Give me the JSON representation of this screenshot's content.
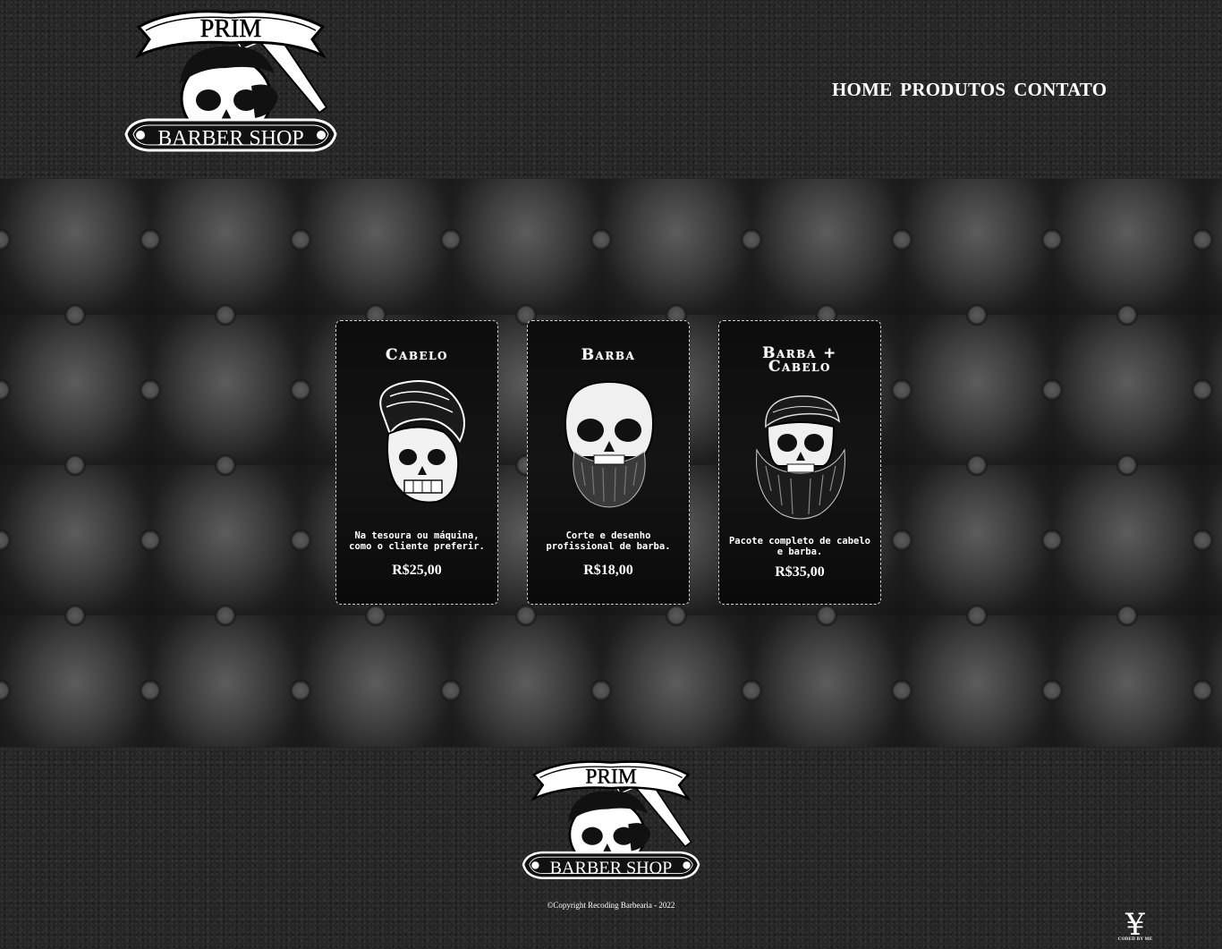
{
  "brand": {
    "logo_top": "PRIM",
    "logo_bottom": "BARBER SHOP"
  },
  "nav": {
    "items": [
      {
        "label": "HOME"
      },
      {
        "label": "PRODUTOS"
      },
      {
        "label": "CONTATO"
      }
    ]
  },
  "products": [
    {
      "title_lines": [
        "Cabelo"
      ],
      "description": "Na tesoura ou máquina, como o cliente preferir.",
      "price": "R$25,00",
      "icon": "pompadour-skull-icon"
    },
    {
      "title_lines": [
        "Barba"
      ],
      "description": "Corte e desenho profissional de barba.",
      "price": "R$18,00",
      "icon": "bearded-skull-icon"
    },
    {
      "title_lines": [
        "Barba +",
        "Cabelo"
      ],
      "description": "Pacote completo de cabelo e barba.",
      "price": "R$35,00",
      "icon": "hair-beard-skull-icon"
    }
  ],
  "footer": {
    "copyright": "©Copyright Recoding Barbearia - 2022",
    "signature_glyph": "¥",
    "signature_text": "CODED BY ME"
  },
  "colors": {
    "text": "#ffffff",
    "card_bg": "#0e0e0e",
    "card_border": "#cfcfcf",
    "leather": "#262626"
  }
}
